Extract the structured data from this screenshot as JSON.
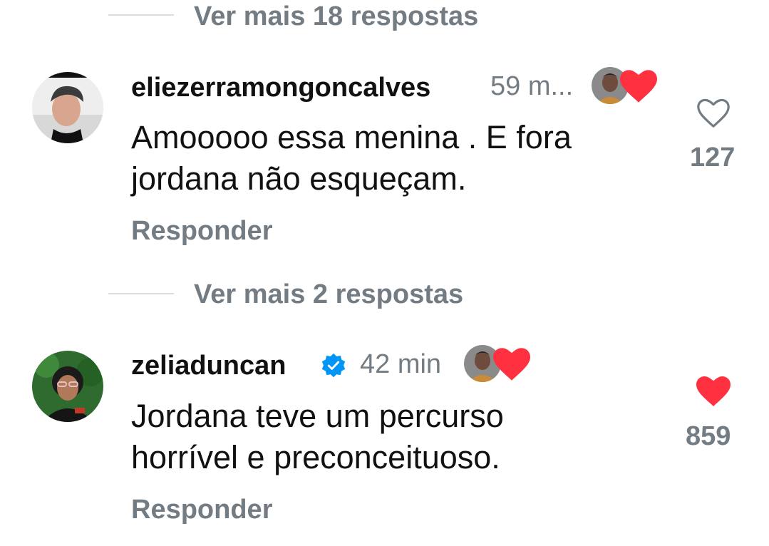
{
  "threads": [
    {
      "view_replies_label": "Ver mais 18 respostas"
    },
    {
      "view_replies_label": "Ver mais 2 respostas"
    }
  ],
  "comments": [
    {
      "username": "eliezerramongoncalves",
      "time": "59 m...",
      "verified": false,
      "text_line1": "Amooooo essa menina . E fora",
      "text_line2": "jordana não esqueçam.",
      "reply_label": "Responder",
      "like_count": "127",
      "liked": false,
      "icon": "heart-outline-icon"
    },
    {
      "username": "zeliaduncan",
      "time": "42 min",
      "verified": true,
      "text_line1": "Jordana teve um percurso",
      "text_line2": "horrível e preconceituoso.",
      "reply_label": "Responder",
      "like_count": "859",
      "liked": true,
      "icon": "heart-filled-icon"
    }
  ],
  "colors": {
    "heart_red": "#ff3040",
    "verified_blue": "#0095f6",
    "muted_text": "#737b83"
  }
}
